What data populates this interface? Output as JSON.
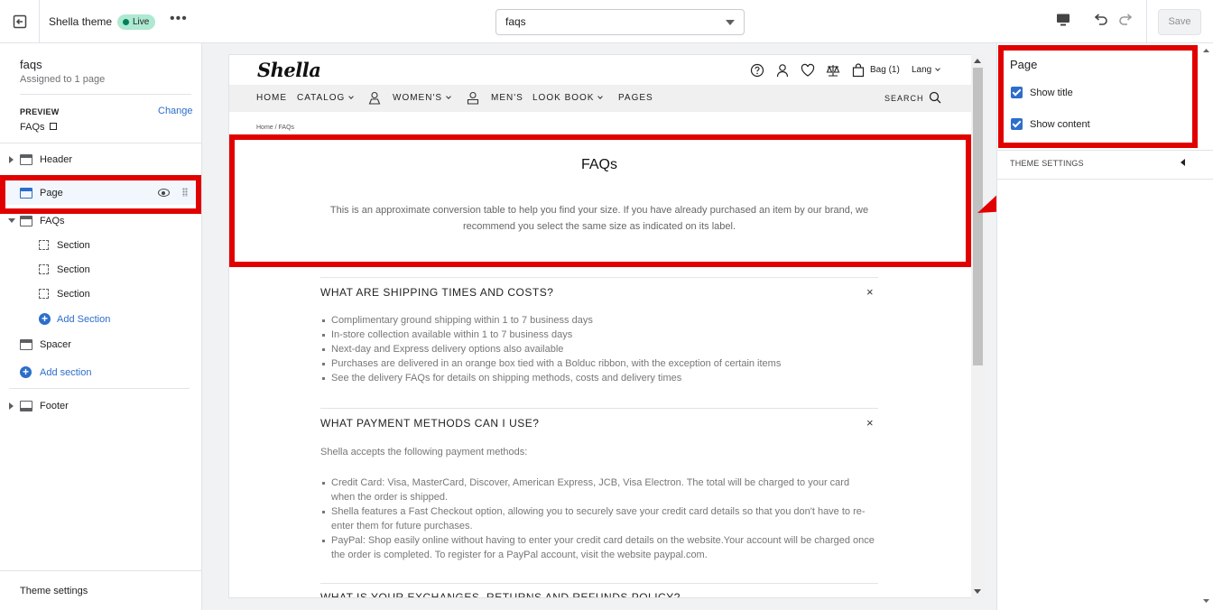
{
  "topbar": {
    "theme_name": "Shella theme",
    "status_badge": "Live",
    "more": "•••",
    "page_select_value": "faqs",
    "save_label": "Save"
  },
  "left": {
    "template_title": "faqs",
    "assigned": "Assigned to 1 page",
    "preview_label": "PREVIEW",
    "change_label": "Change",
    "preview_page": "FAQs",
    "tree": {
      "header": "Header",
      "page": "Page",
      "faqs": "FAQs",
      "section1": "Section",
      "section2": "Section",
      "section3": "Section",
      "add_section_inner": "Add Section",
      "spacer": "Spacer",
      "add_section": "Add section",
      "footer": "Footer"
    },
    "theme_settings": "Theme settings"
  },
  "preview": {
    "logo": "Shella",
    "bag": "Bag (1)",
    "lang": "Lang",
    "nav": {
      "home": "HOME",
      "catalog": "CATALOG",
      "womens": "WOMEN'S",
      "mens": "MEN'S",
      "lookbook": "LOOK BOOK",
      "pages": "PAGES",
      "search": "SEARCH"
    },
    "breadcrumb": "Home  /  FAQs",
    "page_title": "FAQs",
    "page_desc": "This is an approximate conversion table to help you find your size. If you have already purchased an item by our brand, we recommend you select the same size as indicated on its label.",
    "faq1": {
      "question": "WHAT ARE SHIPPING TIMES AND COSTS?",
      "close": "×",
      "items": [
        "Complimentary ground shipping within 1 to 7 business days",
        "In-store collection available within 1 to 7 business days",
        "Next-day and Express delivery options also available",
        "Purchases are delivered in an orange box tied with a Bolduc ribbon, with the exception of certain items",
        "See the delivery FAQs for details on shipping methods, costs and delivery times"
      ]
    },
    "faq2": {
      "question": "WHAT PAYMENT METHODS CAN I USE?",
      "close": "×",
      "intro": "Shella accepts the following payment methods:",
      "items": [
        "Credit Card: Visa, MasterCard, Discover, American Express, JCB, Visa Electron. The total will be charged to your card when the order is shipped.",
        "Shella features a Fast Checkout option, allowing you to securely save your credit card details so that you don't have to re-enter them for future purchases.",
        "PayPal: Shop easily online without having to enter your credit card details on the website.Your account will be charged once the order is completed. To register for a PayPal account, visit the website paypal.com."
      ]
    },
    "faq3": {
      "question": "WHAT IS YOUR EXCHANGES, RETURNS AND REFUNDS POLICY?"
    }
  },
  "right": {
    "title": "Page",
    "show_title": "Show title",
    "show_content": "Show content",
    "theme_settings": "THEME SETTINGS"
  },
  "colors": {
    "accent": "#2c6ecb",
    "highlight": "#e10000",
    "live_badge": "#aee9d1"
  }
}
